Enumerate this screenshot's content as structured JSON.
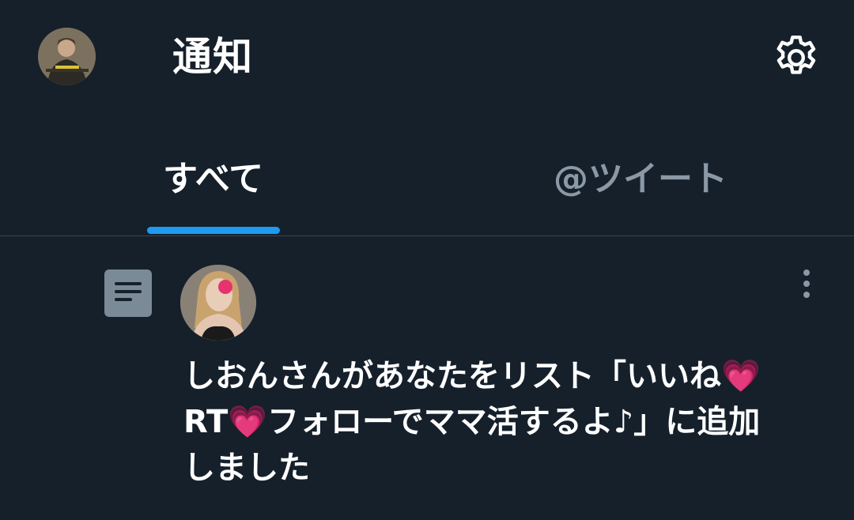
{
  "header": {
    "title": "通知",
    "settings_icon": "gear-icon"
  },
  "tabs": [
    {
      "label": "すべて",
      "active": true
    },
    {
      "label": "@ツイート",
      "active": false
    }
  ],
  "colors": {
    "background": "#15202b",
    "accent": "#1d9bf0",
    "muted_text": "#8b98a5",
    "divider": "#38444d"
  },
  "notification": {
    "type_icon": "list-icon",
    "more_icon": "more-vertical-icon",
    "text": "しおんさんがあなたをリスト「いいね💗RT💗フォローでママ活するよ♪」に追加しました"
  }
}
